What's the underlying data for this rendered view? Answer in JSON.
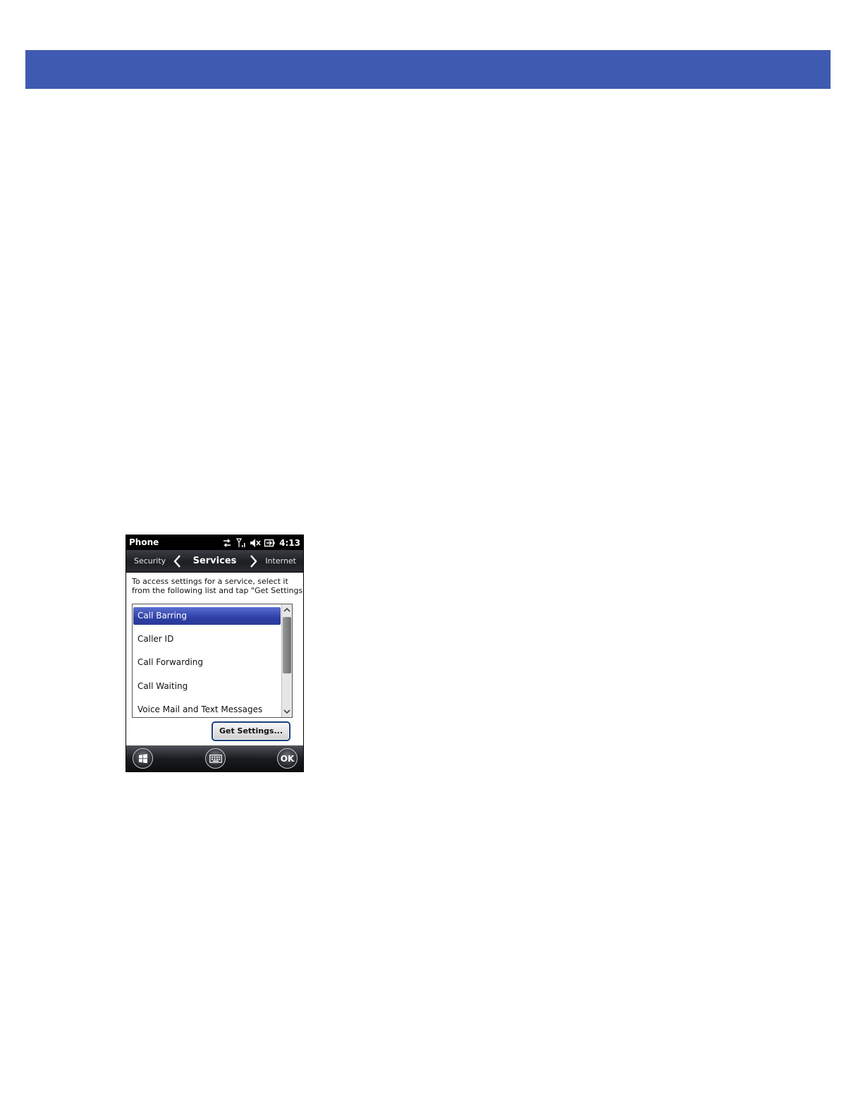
{
  "device": {
    "status_bar": {
      "title": "Phone",
      "time": "4:13"
    },
    "tabs": {
      "left": "Security",
      "current": "Services",
      "right": "Internet"
    },
    "instructions": [
      "To access settings for a service, select it",
      "from the following list and tap \"Get Settings\"."
    ],
    "services": [
      {
        "label": "Call Barring",
        "selected": true
      },
      {
        "label": "Caller ID"
      },
      {
        "label": "Call Forwarding"
      },
      {
        "label": "Call Waiting"
      },
      {
        "label": "Voice Mail and Text Messages"
      }
    ],
    "get_settings_label": "Get Settings...",
    "softkeys": {
      "ok_label": "OK"
    }
  },
  "colors": {
    "header_band": "#3f5bb1",
    "selection": "#2e3fa6"
  }
}
